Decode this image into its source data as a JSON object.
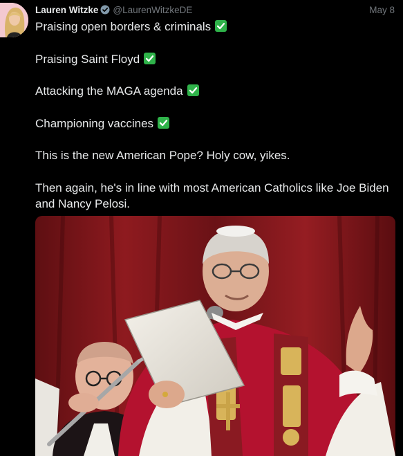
{
  "tweet": {
    "author_name": "Lauren Witzke",
    "author_handle": "@LaurenWitzkeDE",
    "date": "May 8",
    "verified_icon": "verified-badge-icon",
    "lines": [
      "Praising open borders & criminals",
      "Praising Saint Floyd",
      "Attacking the MAGA agenda",
      "Championing vaccines",
      "This is the new American Pope? Holy cow, yikes.",
      "Then again, he's in line with most American Catholics like Joe Biden and Nancy Pelosi."
    ],
    "check_icon": "check-mark-button-icon",
    "media_alt": "photo-of-pope-reading-from-paper"
  },
  "colors": {
    "background": "#000000",
    "text": "#e7e9ea",
    "muted": "#71767b",
    "verified": "#829aab",
    "check": "#2fb34a"
  }
}
